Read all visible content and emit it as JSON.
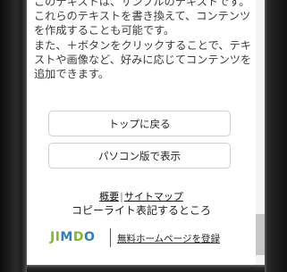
{
  "content": {
    "paragraph": "このテキストは、サンプルのテキストです。これらのテキストを書き換えて、コンテンツを作成することも可能です。\nまた、＋ボタンをクリックすることで、テキストや画像など、好みに応じてコンテンツを追加できます。"
  },
  "buttons": {
    "back_to_top": "トップに戻る",
    "pc_version": "パソコン版で表示"
  },
  "footer": {
    "link_about": "概要",
    "separator": "|",
    "link_sitemap": "サイトマップ",
    "copyright": "コピーライト表記するところ",
    "jimdo_logo_text": "JIMDO",
    "jimdo_link": "無料ホームページを登録"
  },
  "colors": {
    "jimdo_green": "#7cbb2a",
    "jimdo_blue": "#2f7fbf"
  }
}
